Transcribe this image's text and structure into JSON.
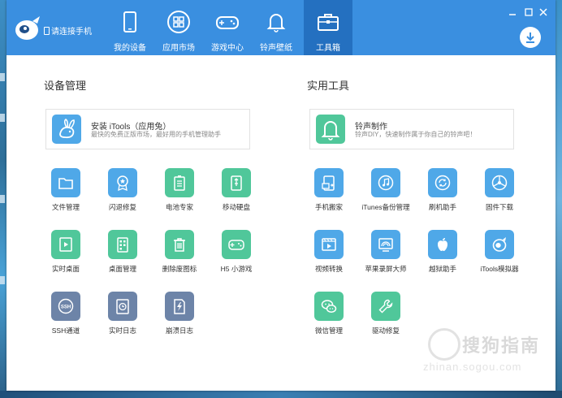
{
  "titlebar": {
    "connect_text": "请连接手机",
    "nav": [
      {
        "label": "我的设备",
        "icon": "phone-icon"
      },
      {
        "label": "应用市场",
        "icon": "apps-icon"
      },
      {
        "label": "游戏中心",
        "icon": "gamepad-icon"
      },
      {
        "label": "铃声壁纸",
        "icon": "bell-icon"
      },
      {
        "label": "工具箱",
        "icon": "toolbox-icon"
      }
    ],
    "active_tab": "工具箱"
  },
  "left": {
    "title": "设备管理",
    "card": {
      "title": "安装 iTools（应用兔）",
      "subtitle": "最快的免费正版市场，最好用的手机管理助手",
      "icon": "rabbit-icon"
    },
    "tools": [
      {
        "label": "文件管理",
        "icon": "folder-icon",
        "color": "#4fa8e8"
      },
      {
        "label": "闪退修复",
        "icon": "badge-star-icon",
        "color": "#4fa8e8"
      },
      {
        "label": "电池专家",
        "icon": "battery-list-icon",
        "color": "#50c79a"
      },
      {
        "label": "移动硬盘",
        "icon": "usb-drive-icon",
        "color": "#50c79a"
      },
      {
        "label": "实时桌面",
        "icon": "play-screen-icon",
        "color": "#50c79a"
      },
      {
        "label": "桌面管理",
        "icon": "grid-phone-icon",
        "color": "#50c79a"
      },
      {
        "label": "删除废图标",
        "icon": "trash-icon",
        "color": "#50c79a"
      },
      {
        "label": "H5 小游戏",
        "icon": "gamepad-icon",
        "color": "#50c79a"
      },
      {
        "label": "SSH通道",
        "icon": "ssh-icon",
        "color": "#6d84a8"
      },
      {
        "label": "实时日志",
        "icon": "clock-doc-icon",
        "color": "#6d84a8"
      },
      {
        "label": "崩溃日志",
        "icon": "lightning-doc-icon",
        "color": "#6d84a8"
      }
    ]
  },
  "right": {
    "title": "实用工具",
    "card": {
      "title": "铃声制作",
      "subtitle": "铃声DIY，快速制作属于你自己的铃声吧！",
      "icon": "bell-icon"
    },
    "tools": [
      {
        "label": "手机搬家",
        "icon": "phone-transfer-icon",
        "color": "#4fa8e8"
      },
      {
        "label": "iTunes备份管理",
        "icon": "music-note-icon",
        "color": "#4fa8e8"
      },
      {
        "label": "刷机助手",
        "icon": "refresh-icon",
        "color": "#4fa8e8"
      },
      {
        "label": "固件下载",
        "icon": "wheel-icon",
        "color": "#4fa8e8"
      },
      {
        "label": "视频转换",
        "icon": "video-icon",
        "color": "#4fa8e8"
      },
      {
        "label": "苹果录屏大师",
        "icon": "cast-icon",
        "color": "#4fa8e8"
      },
      {
        "label": "越狱助手",
        "icon": "apple-icon",
        "color": "#4fa8e8"
      },
      {
        "label": "iTools模拟器",
        "icon": "itools-icon",
        "color": "#4fa8e8"
      },
      {
        "label": "微信管理",
        "icon": "wechat-icon",
        "color": "#50c79a"
      },
      {
        "label": "驱动修复",
        "icon": "wrench-icon",
        "color": "#50c79a"
      }
    ]
  },
  "watermark": {
    "text": "搜狗指南",
    "url": "zhinan.sogou.com"
  }
}
